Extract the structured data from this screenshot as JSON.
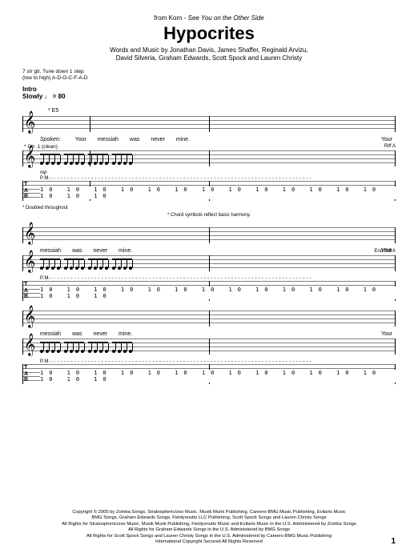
{
  "header": {
    "from_prefix": "from",
    "artist": "Korn",
    "dash": " - ",
    "album": "See You on the Other Side",
    "title": "Hypocrites",
    "credits_line1": "Words and Music by Jonathan Davis, James Shaffer, Reginald Arvizu,",
    "credits_line2": "David Silveria, Graham Edwards, Scott Spock and Lauren Christy"
  },
  "setup": {
    "tuning1": "7 str gtr, Tune down 1 step",
    "tuning2": "(low to high) A-D-G-C-F-A-D",
    "intro": "Intro",
    "tempo": "Slowly ♩ = 80",
    "chord": "* E5"
  },
  "system1": {
    "spoken": "Spoken:",
    "lyrics": [
      "Your",
      "messiah",
      "was",
      "never",
      "mine."
    ],
    "lyric_end": "Your",
    "gtr_label": "* Gtr. 1 (clean)",
    "riff": "Riff A",
    "dynamic": "mp",
    "pm": "P.M.- - - - - - - - - - - - - - - - - - - - - - - - - - - - - - - - - - - - - - - - - - - - - - - - - - - - - - - - - - - - - - - - - - - - - - - - - - - - -",
    "tab_nums": "10 10 10 10 10 10 10 10 10 10 10 10 10 10 10 10",
    "footnote1": "* Doubled throughout",
    "footnote2": "* Chord symbols reflect basic harmony."
  },
  "system2": {
    "lyrics": [
      "messiah",
      "was",
      "never",
      "mine."
    ],
    "lyric_end": "Your",
    "riff_end": "End Riff A",
    "tab_nums": "10 10 10 10 10 10 10 10 10 10 10 10 10 10 10 10"
  },
  "system3": {
    "lyrics": [
      "messiah",
      "was",
      "never",
      "mine."
    ],
    "lyric_end": "Your",
    "tab_nums": "10 10 10 10 10 10 10 10 10 10 10 10 10 10 10 10"
  },
  "copyright": {
    "c1": "Copyright © 2005 by Zomba Songs, Stratospheric/zoo Music, Musik Munk Publishing, Careers-BMG Music Publishing, Evilarts Music",
    "c2": "BMG Songs, Graham Edwards Songs, Fieldysnuttz LLC Publishing, Scott Spock Songs and Lauren Christy Songs",
    "c3": "All Rights for Stratospheric/zoo Music, Musik Munk Publishing, Fieldysnuttz Music and Evilarts Music in the U.S. Administered by Zomba Songs",
    "c4": "All Rights for Graham Edwards Songs in the U.S. Administered by BMG Songs",
    "c5": "All Rights for Scott Spock Songs and Lauren Christy Songs in the U.S. Administered by Careers-BMG Music Publishing",
    "c6": "International Copyright Secured   All Rights Reserved"
  },
  "page_number": "1",
  "tab_letters": {
    "t": "T",
    "a": "A",
    "b": "B"
  }
}
